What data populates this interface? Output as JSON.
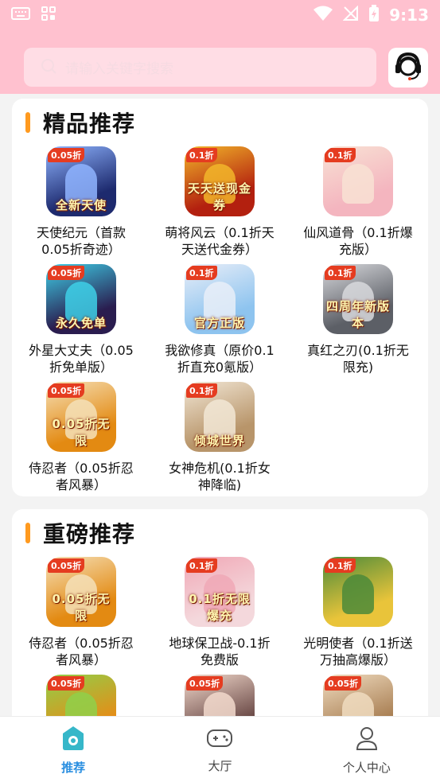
{
  "status": {
    "time": "9:13"
  },
  "search": {
    "placeholder": "请输入关键字搜索"
  },
  "colors": {
    "header_pink": "#ffc1cf",
    "accent_orange": "#ff9a1f",
    "active_blue": "#2b8fe0"
  },
  "sections": [
    {
      "title": "精品推荐",
      "games": [
        {
          "name": "天使纪元（首款0.05折奇迹）",
          "badge": "0.05折",
          "banner": "全新天使",
          "bg": "#1d2a6e",
          "fig": "#8fb4ff"
        },
        {
          "name": "萌将风云（0.1折天天送代金券）",
          "badge": "0.1折",
          "banner": "天天送现金券",
          "bg": "#b3200f",
          "fig": "#f2b62a"
        },
        {
          "name": "仙风道骨（0.1折爆充版）",
          "badge": "0.1折",
          "banner": "",
          "bg": "#f4b5bf",
          "fig": "#f8e2d4"
        },
        {
          "name": "外星大丈夫（0.05折免单版）",
          "badge": "0.05折",
          "banner": "永久免单",
          "bg": "#2a1d4f",
          "fig": "#3ed0e8"
        },
        {
          "name": "我欲修真（原价0.1折直充0氪版）",
          "badge": "0.1折",
          "banner": "官方正版",
          "bg": "#8ec4ef",
          "fig": "#e9eef8"
        },
        {
          "name": "真红之刃(0.1折无限充)",
          "badge": "0.1折",
          "banner": "四周年新版本",
          "bg": "#5c5f66",
          "fig": "#d8d9dd"
        },
        {
          "name": "侍忍者（0.05折忍者风暴）",
          "badge": "0.05折",
          "banner": "0.05折无限",
          "bg": "#e38a12",
          "fig": "#f5e0b8"
        },
        {
          "name": "女神危机(0.1折女神降临)",
          "badge": "0.1折",
          "banner": "倾城世界",
          "bg": "#b8956a",
          "fig": "#f2e7d6"
        }
      ]
    },
    {
      "title": "重磅推荐",
      "games": [
        {
          "name": "侍忍者（0.05折忍者风暴）",
          "badge": "0.05折",
          "banner": "0.05折无限",
          "bg": "#e38a12",
          "fig": "#f5e0b8"
        },
        {
          "name": "地球保卫战-0.1折免费版",
          "badge": "0.1折",
          "banner": "0.1折无限爆充",
          "bg": "#f4d8dc",
          "fig": "#f0a8b6"
        },
        {
          "name": "光明使者（0.1折送万抽高爆版）",
          "badge": "0.1折",
          "banner": "",
          "bg": "#e9c43a",
          "fig": "#4b8a3a"
        },
        {
          "name": "",
          "badge": "0.05折",
          "banner": "",
          "bg": "#e58d17",
          "fig": "#8fd04a"
        },
        {
          "name": "",
          "badge": "0.05折",
          "banner": "",
          "bg": "#6b4a47",
          "fig": "#f2d9cc"
        },
        {
          "name": "",
          "badge": "0.05折",
          "banner": "",
          "bg": "#a87e52",
          "fig": "#f0dcc0"
        }
      ]
    }
  ],
  "nav": {
    "items": [
      {
        "label": "推荐",
        "icon": "home-icon",
        "active": true
      },
      {
        "label": "大厅",
        "icon": "gamepad-icon",
        "active": false
      },
      {
        "label": "个人中心",
        "icon": "user-icon",
        "active": false
      }
    ]
  }
}
